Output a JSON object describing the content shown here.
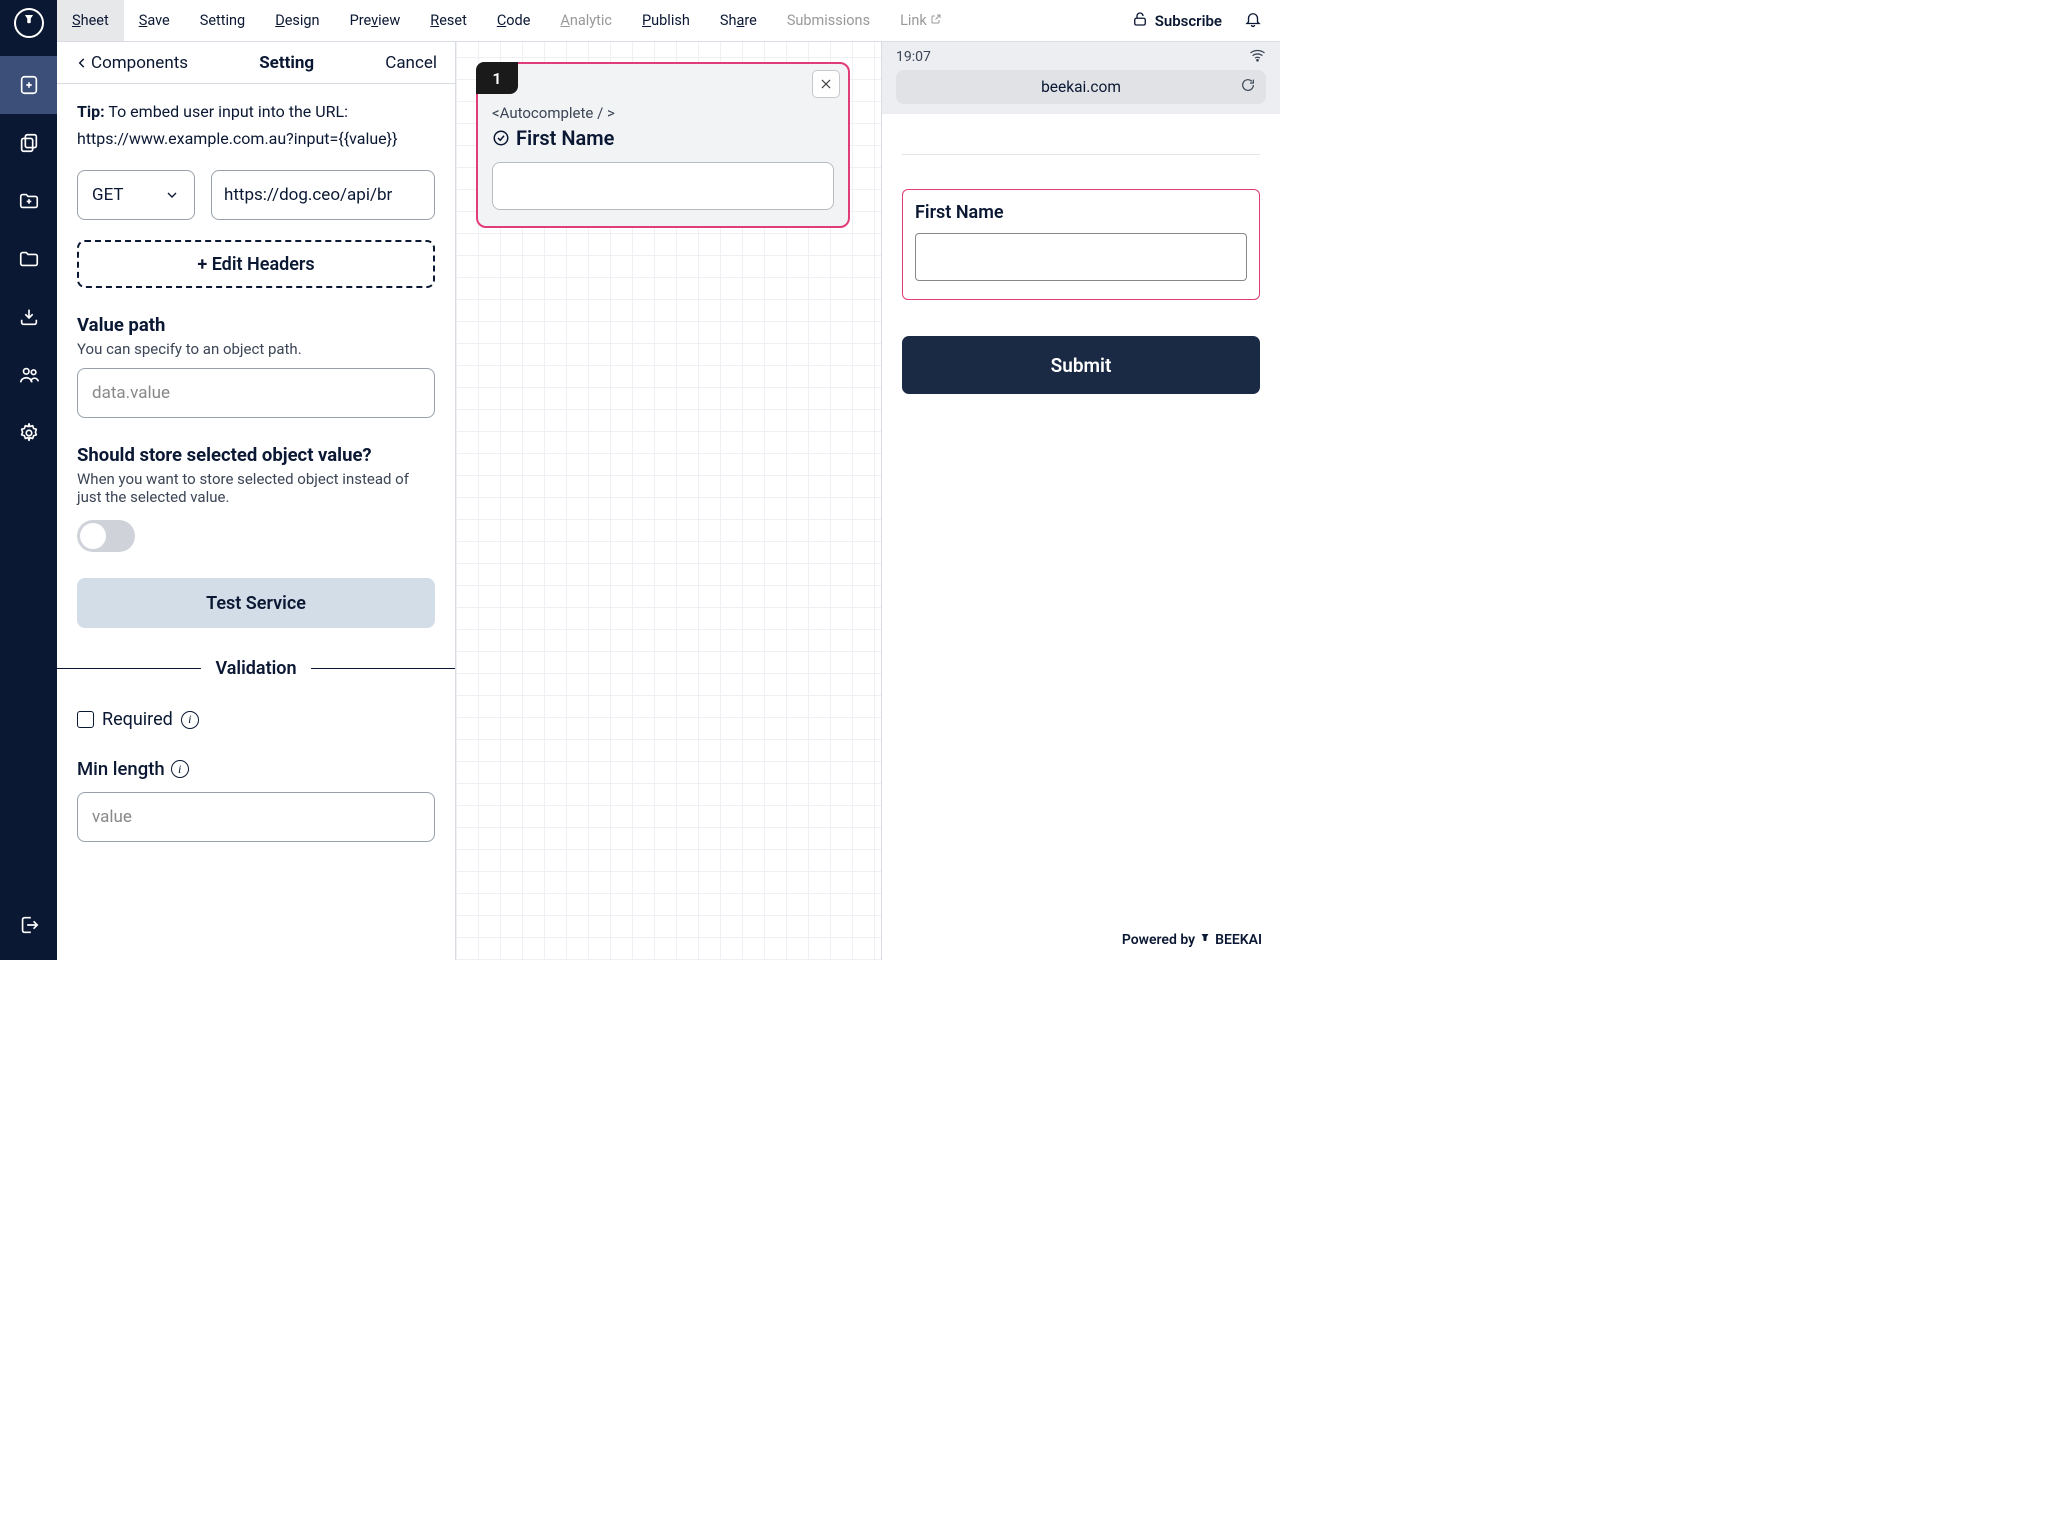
{
  "menubar": {
    "items": [
      {
        "letter": "S",
        "rest": "heet",
        "active": true
      },
      {
        "letter": "S",
        "rest": "ave"
      },
      {
        "label": "Setting"
      },
      {
        "letter": "D",
        "rest": "esign"
      },
      {
        "label_pre": "Pre",
        "letter": "v",
        "label_post": "iew"
      },
      {
        "letter": "R",
        "rest": "eset"
      },
      {
        "letter": "C",
        "rest": "ode"
      },
      {
        "letter": "A",
        "rest": "nalytic",
        "disabled": true
      },
      {
        "letter": "P",
        "rest": "ublish"
      },
      {
        "label_pre": "Sh",
        "letter": "a",
        "label_post": "re"
      },
      {
        "label": "Submissions",
        "disabled": true
      },
      {
        "label": "Link",
        "disabled": true,
        "ext": true
      }
    ],
    "subscribe": "Subscribe"
  },
  "panel": {
    "back": "Components",
    "title": "Setting",
    "cancel": "Cancel",
    "tip_b": "Tip:",
    "tip_l1": " To embed user input into the URL:",
    "tip_l2": "https://www.example.com.au?input={{value}}",
    "method": "GET",
    "url": "https://dog.ceo/api/br",
    "editHeaders": "+ Edit Headers",
    "valuePath": {
      "label": "Value path",
      "desc": "You can specify to an object path.",
      "placeholder": "data.value"
    },
    "storeObj": {
      "label": "Should store selected object value?",
      "desc": "When you want to store selected object instead of just the selected value."
    },
    "test": "Test Service",
    "validation": "Validation",
    "required": "Required",
    "minLength": {
      "label": "Min length",
      "placeholder": "value"
    }
  },
  "canvas": {
    "card": {
      "num": "1",
      "tag": "<Autocomplete / >",
      "title": "First Name"
    }
  },
  "preview": {
    "time": "19:07",
    "url": "beekai.com",
    "field": "First Name",
    "submit": "Submit",
    "powered_pre": "Powered by",
    "powered_brand": "BEEKAI"
  }
}
